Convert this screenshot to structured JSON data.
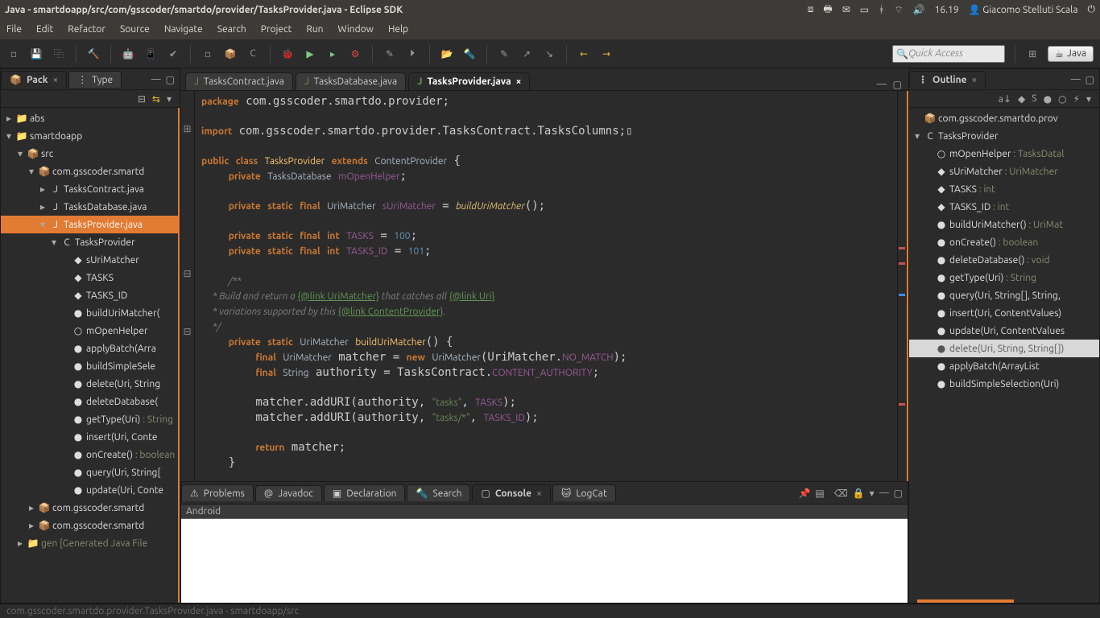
{
  "window": {
    "title": "Java - smartdoapp/src/com/gsscoder/smartdo/provider/TasksProvider.java - Eclipse SDK",
    "time": "16.19",
    "user": "Giacomo Stelluti Scala"
  },
  "menu": [
    "File",
    "Edit",
    "Refactor",
    "Source",
    "Navigate",
    "Search",
    "Project",
    "Run",
    "Window",
    "Help"
  ],
  "quick_access_placeholder": "Quick Access",
  "perspectives": {
    "java": "Java"
  },
  "left_tabs": [
    {
      "label": "Pack",
      "active": true
    },
    {
      "label": "Type",
      "active": false
    }
  ],
  "package_tree": [
    {
      "depth": 0,
      "tw": "▸",
      "icon": "📁",
      "label": "abs"
    },
    {
      "depth": 0,
      "tw": "▾",
      "icon": "📁",
      "label": "smartdoapp"
    },
    {
      "depth": 1,
      "tw": "▾",
      "icon": "📦",
      "label": "src"
    },
    {
      "depth": 2,
      "tw": "▾",
      "icon": "📦",
      "label": "com.gsscoder.smartdo.provider",
      "trunc": "com.gsscoder.smartd"
    },
    {
      "depth": 3,
      "tw": "▸",
      "icon": "J",
      "label": "TasksContract.java"
    },
    {
      "depth": 3,
      "tw": "▸",
      "icon": "J",
      "label": "TasksDatabase.java"
    },
    {
      "depth": 3,
      "tw": "▾",
      "icon": "J",
      "label": "TasksProvider.java",
      "selected": true
    },
    {
      "depth": 4,
      "tw": "▾",
      "icon": "C",
      "label": "TasksProvider"
    },
    {
      "depth": 5,
      "tw": "",
      "icon": "◆",
      "label": "sUriMatcher"
    },
    {
      "depth": 5,
      "tw": "",
      "icon": "◆",
      "label": "TASKS"
    },
    {
      "depth": 5,
      "tw": "",
      "icon": "◆",
      "label": "TASKS_ID"
    },
    {
      "depth": 5,
      "tw": "",
      "icon": "●",
      "label": "buildUriMatcher()",
      "trunc": "buildUriMatcher("
    },
    {
      "depth": 5,
      "tw": "",
      "icon": "○",
      "label": "mOpenHelper"
    },
    {
      "depth": 5,
      "tw": "",
      "icon": "●",
      "label": "applyBatch(ArrayList<ContentProviderOperation>)",
      "trunc": "applyBatch(Arra"
    },
    {
      "depth": 5,
      "tw": "",
      "icon": "●",
      "label": "buildSimpleSelection(Uri)",
      "trunc": "buildSimpleSele"
    },
    {
      "depth": 5,
      "tw": "",
      "icon": "●",
      "label": "delete(Uri, String, String[])",
      "trunc": "delete(Uri, String"
    },
    {
      "depth": 5,
      "tw": "",
      "icon": "●",
      "label": "deleteDatabase()",
      "trunc": "deleteDatabase("
    },
    {
      "depth": 5,
      "tw": "",
      "icon": "●",
      "label": "getType(Uri)",
      "suffix": ": String",
      "trunc": "getType(Uri) "
    },
    {
      "depth": 5,
      "tw": "",
      "icon": "●",
      "label": "insert(Uri, ContentValues)",
      "trunc": "insert(Uri, Conte"
    },
    {
      "depth": 5,
      "tw": "",
      "icon": "●",
      "label": "onCreate()",
      "suffix": ": boolean",
      "trunc": "onCreate() "
    },
    {
      "depth": 5,
      "tw": "",
      "icon": "●",
      "label": "query(Uri, String[], String, String[], String)",
      "trunc": "query(Uri, String["
    },
    {
      "depth": 5,
      "tw": "",
      "icon": "●",
      "label": "update(Uri, ContentValues, String, String[])",
      "trunc": "update(Uri, Conte"
    },
    {
      "depth": 2,
      "tw": "▸",
      "icon": "📦",
      "label": "com.gsscoder.smartdo",
      "trunc": "com.gsscoder.smartd"
    },
    {
      "depth": 2,
      "tw": "▸",
      "icon": "📦",
      "label": "com.gsscoder.smartdo",
      "trunc": "com.gsscoder.smartd"
    },
    {
      "depth": 1,
      "tw": "▸",
      "icon": "📁",
      "label": "gen [Generated Java Files]",
      "trunc": "gen [Generated Java File",
      "muted": true
    }
  ],
  "editor_tabs": [
    {
      "label": "TasksContract.java",
      "active": false
    },
    {
      "label": "TasksDatabase.java",
      "active": false
    },
    {
      "label": "TasksProvider.java",
      "active": true
    }
  ],
  "code": {
    "package": "com.gsscoder.smartdo.provider",
    "import": "com.gsscoder.smartdo.provider.TasksContract.TasksColumns",
    "class": "TasksProvider",
    "extends": "ContentProvider",
    "field_db_type": "TasksDatabase",
    "field_db": "mOpenHelper",
    "field_matcher_type": "UriMatcher",
    "field_matcher": "sUriMatcher",
    "field_matcher_init": "buildUriMatcher",
    "tasks_const": "TASKS",
    "tasks_val": "100",
    "tasks_id_const": "TASKS_ID",
    "tasks_id_val": "101",
    "comment1": " * Build and return a ",
    "comment1b": " that catches all ",
    "comment2": " * variations supported by this ",
    "link_urimatcher": "{@link UriMatcher}",
    "link_uri": "{@link Uri}",
    "link_cp": "{@link ContentProvider}",
    "method": "buildUriMatcher",
    "local_matcher": "matcher",
    "no_match": "NO_MATCH",
    "local_auth": "authority",
    "auth_src": "TasksContract",
    "auth_const": "CONTENT_AUTHORITY",
    "str_tasks": "\"tasks\"",
    "str_tasks_star": "\"tasks/*\""
  },
  "outline_tab": "Outline",
  "outline": [
    {
      "depth": 0,
      "icon": "📦",
      "label": "com.gsscoder.smartdo.provider",
      "trunc": "com.gsscoder.smartdo.prov"
    },
    {
      "depth": 0,
      "tw": "▾",
      "icon": "C",
      "label": "TasksProvider"
    },
    {
      "depth": 1,
      "icon": "○",
      "label": "mOpenHelper",
      "suffix": ": TasksDatabase",
      "trunc_suffix": ": TasksDatal"
    },
    {
      "depth": 1,
      "icon": "◆",
      "label": "sUriMatcher",
      "suffix": ": UriMatcher"
    },
    {
      "depth": 1,
      "icon": "◆",
      "label": "TASKS",
      "suffix": ": int"
    },
    {
      "depth": 1,
      "icon": "◆",
      "label": "TASKS_ID",
      "suffix": ": int"
    },
    {
      "depth": 1,
      "icon": "●",
      "label": "buildUriMatcher()",
      "suffix": ": UriMatcher",
      "trunc_suffix": ": UriMat"
    },
    {
      "depth": 1,
      "icon": "●",
      "label": "onCreate()",
      "suffix": ": boolean"
    },
    {
      "depth": 1,
      "icon": "●",
      "label": "deleteDatabase()",
      "suffix": ": void"
    },
    {
      "depth": 1,
      "icon": "●",
      "label": "getType(Uri)",
      "suffix": ": String"
    },
    {
      "depth": 1,
      "icon": "●",
      "label": "query(Uri, String[], String, String[], String)",
      "trunc": "query(Uri, String[], String, "
    },
    {
      "depth": 1,
      "icon": "●",
      "label": "insert(Uri, ContentValues)"
    },
    {
      "depth": 1,
      "icon": "●",
      "label": "update(Uri, ContentValues, String, String[])",
      "trunc": "update(Uri, ContentValues"
    },
    {
      "depth": 1,
      "icon": "●",
      "label": "delete(Uri, String, String[])",
      "selected": true
    },
    {
      "depth": 1,
      "icon": "●",
      "label": "applyBatch(ArrayList<ContentProviderOperation>)",
      "trunc": "applyBatch(ArrayList<Con"
    },
    {
      "depth": 1,
      "icon": "●",
      "label": "buildSimpleSelection(Uri)"
    }
  ],
  "bottom_tabs": [
    {
      "label": "Problems",
      "icon": "⚠"
    },
    {
      "label": "Javadoc",
      "icon": "@"
    },
    {
      "label": "Declaration",
      "icon": "▣"
    },
    {
      "label": "Search",
      "icon": "🔦"
    },
    {
      "label": "Console",
      "icon": "▢",
      "active": true
    },
    {
      "label": "LogCat",
      "icon": "🐱"
    }
  ],
  "console_header": "Android",
  "status": "com.gsscoder.smartdo.provider.TasksProvider.java - smartdoapp/src"
}
